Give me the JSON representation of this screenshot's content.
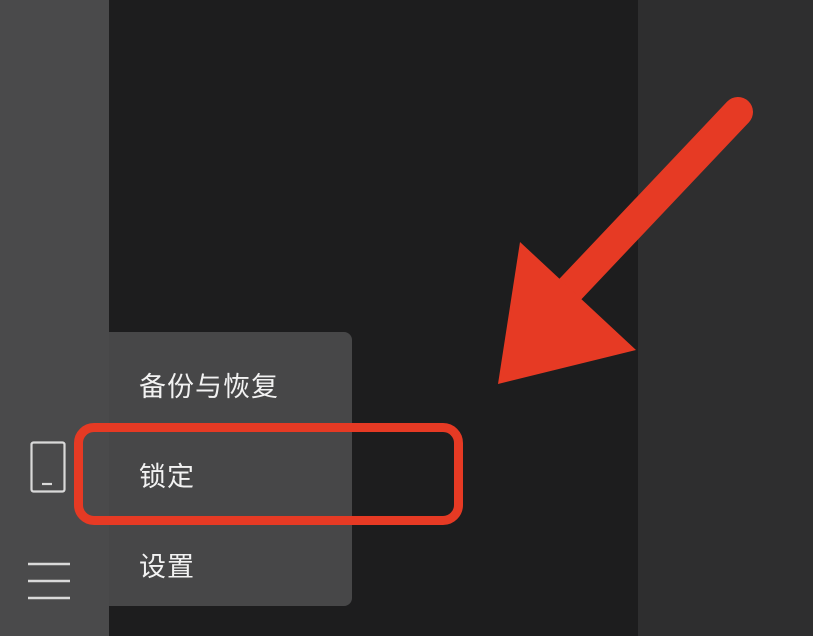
{
  "sidebar": {
    "device_icon": "tablet-icon",
    "menu_icon": "hamburger-menu-icon"
  },
  "popup_menu": {
    "items": [
      {
        "label": "备份与恢复"
      },
      {
        "label": "锁定"
      },
      {
        "label": "设置"
      }
    ]
  },
  "annotation": {
    "highlight_color": "#e63a24",
    "arrow_color": "#e63a24",
    "highlighted_item": "锁定"
  },
  "colors": {
    "sidebar": "#4a4a4b",
    "content": "#1d1d1e",
    "right_panel": "#2e2e2f",
    "menu_background": "#474748",
    "menu_text": "#f2f2f2"
  }
}
